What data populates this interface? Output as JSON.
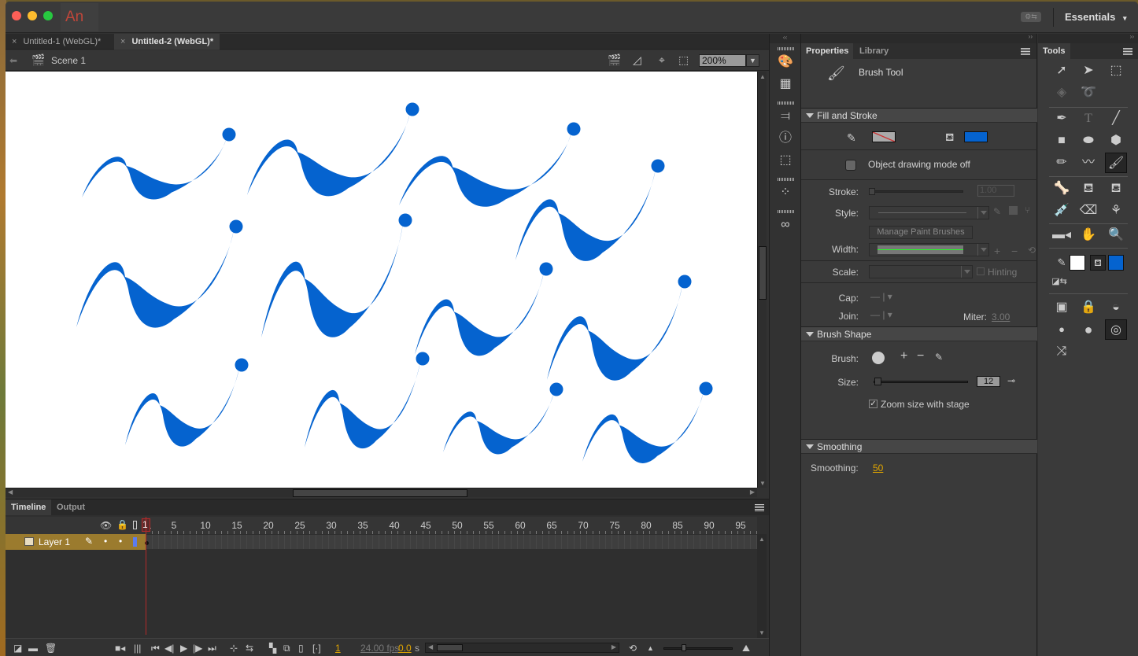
{
  "app": {
    "name": "An",
    "workspace": "Essentials"
  },
  "document_tabs": [
    {
      "label": "Untitled-1 (WebGL)*",
      "active": false
    },
    {
      "label": "Untitled-2 (WebGL)*",
      "active": true
    }
  ],
  "edit_bar": {
    "scene": "Scene 1",
    "zoom": "200%"
  },
  "stage": {
    "stroke_color": "#0563cf",
    "background": "#ffffff"
  },
  "timeline": {
    "tabs": [
      "Timeline",
      "Output"
    ],
    "frame_numbers": [
      "1",
      "5",
      "10",
      "15",
      "20",
      "25",
      "30",
      "35",
      "40",
      "45",
      "50",
      "55",
      "60",
      "65",
      "70",
      "75",
      "80",
      "85",
      "90",
      "95"
    ],
    "layer": {
      "name": "Layer 1",
      "color": "#5c7cf0"
    },
    "current_frame": "1",
    "fps": "24.00 fps",
    "time": "0.0",
    "time_unit": "s"
  },
  "properties": {
    "tabs": [
      "Properties",
      "Library"
    ],
    "tool_name": "Brush Tool",
    "fill_stroke": {
      "title": "Fill and Stroke",
      "fill_color": "#0563cf",
      "object_drawing": "Object drawing mode off",
      "stroke_label": "Stroke:",
      "stroke_value": "1.00",
      "style_label": "Style:",
      "manage_brushes": "Manage Paint Brushes",
      "width_label": "Width:",
      "scale_label": "Scale:",
      "hinting": "Hinting",
      "cap_label": "Cap:",
      "join_label": "Join:",
      "miter_label": "Miter:",
      "miter_value": "3.00"
    },
    "brush_shape": {
      "title": "Brush Shape",
      "brush_label": "Brush:",
      "size_label": "Size:",
      "size_value": "12",
      "zoom_size": "Zoom size with stage",
      "zoom_size_checked": true
    },
    "smoothing": {
      "title": "Smoothing",
      "label": "Smoothing:",
      "value": "50"
    }
  },
  "tools": {
    "title": "Tools",
    "selected": "brush-tool",
    "stroke_swatch": "#ffffff",
    "fill_swatch": "#0563cf"
  }
}
